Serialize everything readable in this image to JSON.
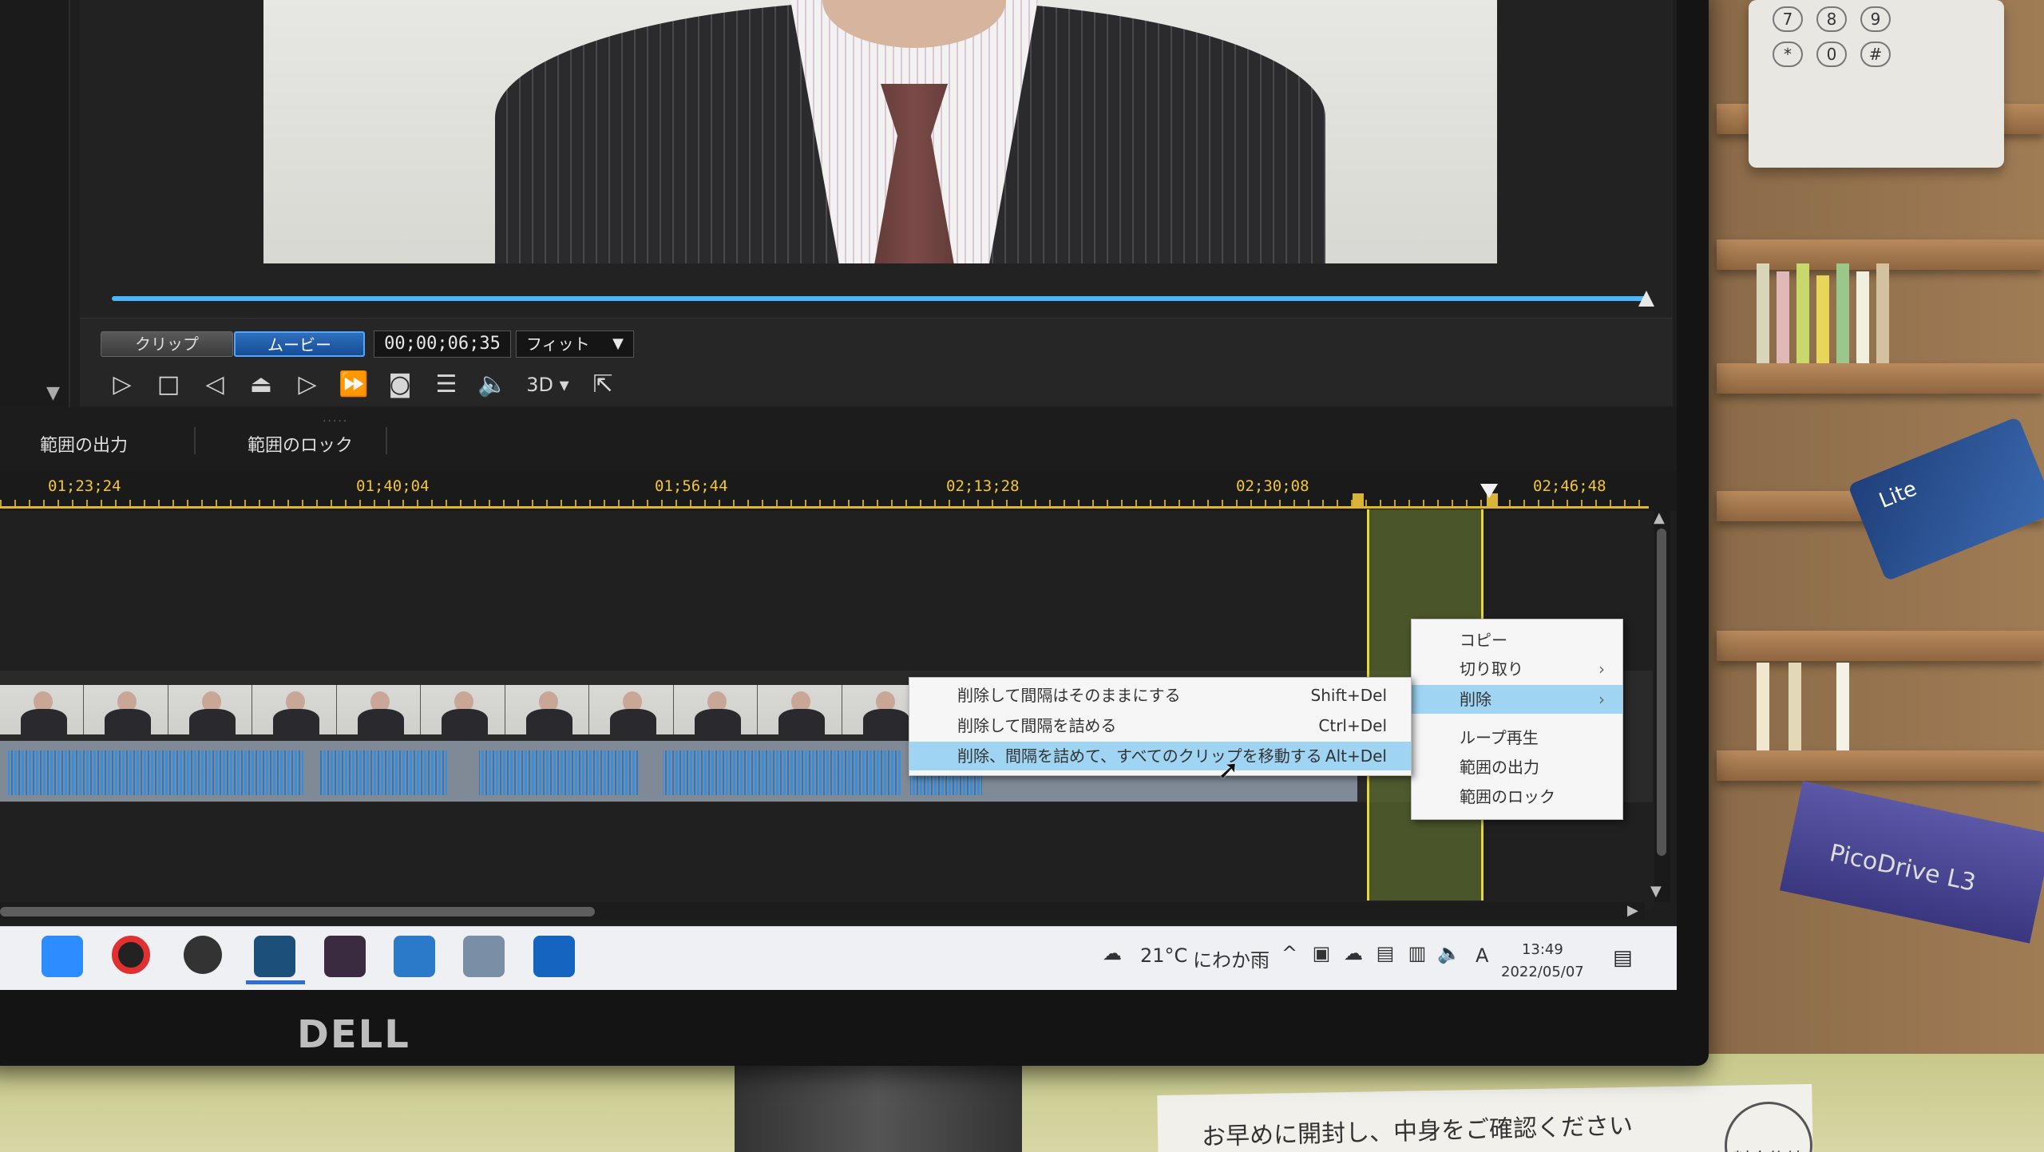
{
  "preview": {
    "mode_clip": "クリップ",
    "mode_movie": "ムービー",
    "timecode": "00;00;06;35",
    "fit": "フィット",
    "three_d": "3D"
  },
  "range_tabs": [
    "範囲の出力",
    "範囲のロック"
  ],
  "ruler": [
    "01;23;24",
    "01;40;04",
    "01;56;44",
    "02;13;28",
    "02;30;08",
    "02;46;48"
  ],
  "context_menu": {
    "items": [
      {
        "label": "コピー"
      },
      {
        "label": "切り取り",
        "submenu": true
      },
      {
        "label": "削除",
        "submenu": true,
        "highlighted": true
      },
      {
        "label": "ループ再生"
      },
      {
        "label": "範囲の出力"
      },
      {
        "label": "範囲のロック"
      }
    ]
  },
  "delete_submenu": {
    "items": [
      {
        "label": "削除して間隔はそのままにする",
        "shortcut": "Shift+Del"
      },
      {
        "label": "削除して間隔を詰める",
        "shortcut": "Ctrl+Del"
      },
      {
        "label": "削除、間隔を詰めて、すべてのクリップを移動する",
        "shortcut": "Alt+Del",
        "highlighted": true
      }
    ]
  },
  "taskbar": {
    "weather_temp": "21°C",
    "weather_desc": "にわか雨",
    "ime": "A",
    "time": "13:49",
    "date": "2022/05/07"
  },
  "monitor_logo": "DELL",
  "desk_paper_text": "お早めに開封し、中身をご確認ください",
  "desk_stamp_text": "料金後納",
  "card_text": "Lite",
  "box_text": "PicoDrive L3"
}
